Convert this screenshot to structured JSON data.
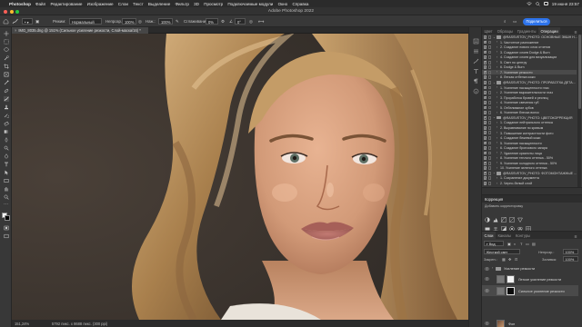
{
  "menubar": {
    "app": "Photoshop",
    "items": [
      "Файл",
      "Редактирование",
      "Изображение",
      "Слои",
      "Текст",
      "Выделение",
      "Фильтр",
      "3D",
      "Просмотр",
      "Подключаемые модули",
      "Окно",
      "Справка"
    ],
    "clock": "19 июня 23:57"
  },
  "window": {
    "title": "Adobe Photoshop 2022"
  },
  "options": {
    "mode_label": "Режим:",
    "mode_value": "Нормальный",
    "opacity_label": "Непрозр.:",
    "opacity_value": "100%",
    "flow_label": "Наж.:",
    "flow_value": "100%",
    "smooth_label": "Сглаживание:",
    "smooth_value": "0%",
    "angle_value": "0°",
    "share_label": "Поделиться"
  },
  "document": {
    "tab": "IMG_8035.dng @ 151% (Сильное усиление резкости, Слой-маска/16) *",
    "zoom": "151,24%",
    "info": "5792 пикс. x 8688 пикс. (300 ppi)"
  },
  "actions_panel": {
    "tabs": [
      "Цвет",
      "Образцы",
      "Градиенты",
      "Операции"
    ],
    "active_tab": "Операции",
    "items": [
      {
        "label": "@RASSVETOV_PHOTO: ОСНОВНЫЕ ЭКШН Н...",
        "type": "set",
        "expanded": true,
        "level": 0
      },
      {
        "label": "1. Частотное разложение",
        "type": "action",
        "level": 1
      },
      {
        "label": "2. Создание нового слоя отчетов",
        "type": "action",
        "level": 1
      },
      {
        "label": "3. Создание слоев Dodge & Burn",
        "type": "action",
        "level": 1
      },
      {
        "label": "4. Создание слоев для визуализации",
        "type": "action",
        "level": 1
      },
      {
        "label": "5. Свет по центру",
        "type": "action",
        "level": 1
      },
      {
        "label": "6. Dodge & Burn",
        "type": "action",
        "level": 1
      },
      {
        "label": "7. Усиление резкости",
        "type": "action",
        "level": 1,
        "selected": true
      },
      {
        "label": "8. Легкая отбелка кожи",
        "type": "action",
        "level": 1
      },
      {
        "label": "@RASSVETOV_PHOTO: ПРОРАБОТКА ДЕТА...",
        "type": "set",
        "expanded": true,
        "level": 0
      },
      {
        "label": "1. Усиление насыщенности глаз",
        "type": "action",
        "level": 1
      },
      {
        "label": "2. Усиление выразительности глаз",
        "type": "action",
        "level": 1
      },
      {
        "label": "3. Проработка бровей и ресниц",
        "type": "action",
        "level": 1
      },
      {
        "label": "4. Усиление свечения губ",
        "type": "action",
        "level": 1
      },
      {
        "label": "5. Отбеливание зубов",
        "type": "action",
        "level": 1
      },
      {
        "label": "6. Усиление блеска волос",
        "type": "action",
        "level": 1
      },
      {
        "label": "@RASSVETOV_PHOTO: ЦВЕТОКОРРЕКЦИЯ",
        "type": "set",
        "expanded": true,
        "level": 0
      },
      {
        "label": "1. Создание нейтрального оттенка",
        "type": "action",
        "level": 1
      },
      {
        "label": "2. Выравнивание по кривым",
        "type": "action",
        "level": 1
      },
      {
        "label": "3. Повышение контрастности фото",
        "type": "action",
        "level": 1
      },
      {
        "label": "4. Создание бежевой кожи",
        "type": "action",
        "level": 1
      },
      {
        "label": "5. Усиление насыщенности",
        "type": "action",
        "level": 1
      },
      {
        "label": "6. Создание бронзового загара",
        "type": "action",
        "level": 1
      },
      {
        "label": "7. Удаление красноты лица",
        "type": "action",
        "level": 1
      },
      {
        "label": "8. Усиление теплого оттенка - 50%",
        "type": "action",
        "level": 1
      },
      {
        "label": "9. Усиление холодного оттенка - 50%",
        "type": "action",
        "level": 1
      },
      {
        "label": "10. Усиление зеленого оттенка",
        "type": "action",
        "level": 1
      },
      {
        "label": "@RASSVETOV_PHOTO: ФОТОМОНТАЖНЫЕ ...",
        "type": "set",
        "expanded": true,
        "level": 0
      },
      {
        "label": "1. Сохранение документа",
        "type": "action",
        "level": 1
      },
      {
        "label": "2. Черно-белый слой",
        "type": "action",
        "level": 1
      }
    ]
  },
  "adjustments_panel": {
    "title": "Коррекция",
    "subtitle": "Добавить корректировку"
  },
  "layers_panel": {
    "tabs": [
      "Слои",
      "Каналы",
      "Контуры"
    ],
    "active_tab": "Слои",
    "filter": "Вид",
    "blend_mode": "Жесткий свет",
    "opacity_label": "Непрозр.:",
    "opacity_value": "100%",
    "lock_label": "Закреп.:",
    "fill_label": "Заливка:",
    "fill_value": "100%",
    "layers": [
      {
        "label": "Усиление резкости",
        "type": "group"
      },
      {
        "label": "Легкое усиление резкости",
        "type": "layer"
      },
      {
        "label": "Сильное усиление резкости",
        "type": "layer",
        "selected": true
      },
      {
        "label": "Фон",
        "type": "background"
      }
    ]
  }
}
